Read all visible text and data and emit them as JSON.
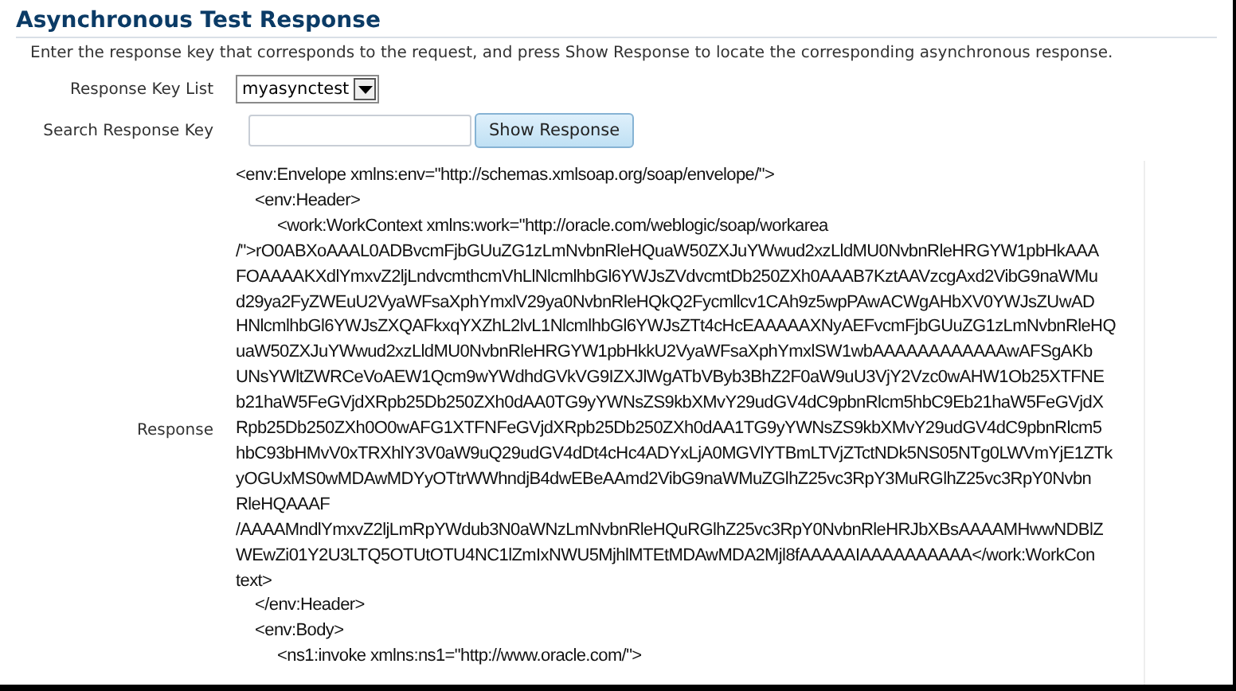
{
  "title": "Asynchronous Test Response",
  "description": "Enter the response key that corresponds to the request, and press Show Response to locate the corresponding asynchronous response.",
  "response_key_list": {
    "label": "Response Key List",
    "value": "myasynctest"
  },
  "search_response_key": {
    "label": "Search Response Key",
    "button": "Show Response"
  },
  "response": {
    "label": "Response",
    "lines": [
      {
        "kind": "flush",
        "text": "<env:Envelope xmlns:env=\"http://schemas.xmlsoap.org/soap/envelope/\">"
      },
      {
        "kind": "indent",
        "text": "<env:Header>"
      },
      {
        "kind": "double",
        "text": "<work:WorkContext xmlns:work=\"http://oracle.com/weblogic/soap/workarea"
      },
      {
        "kind": "flush",
        "text": "/\">rO0ABXoAAAL0ADBvcmFjbGUuZG1zLmNvbnRleHQuaW50ZXJuYWwud2xzLldMU0NvbnRleHRGYW1pbHkAAA"
      },
      {
        "kind": "flush",
        "text": "FOAAAAKXdlYmxvZ2ljLndvcmthcmVhLlNlcmlhbGl6YWJsZVdvcmtDb250ZXh0AAAB7KztAAVzcgAxd2VibG9naWMu"
      },
      {
        "kind": "flush",
        "text": "d29ya2FyZWEuU2VyaWFsaXphYmxlV29ya0NvbnRleHQkQ2Fycmllcv1CAh9z5wpPAwACWgAHbXV0YWJsZUwAD"
      },
      {
        "kind": "flush",
        "text": "HNlcmlhbGl6YWJsZXQAFkxqYXZhL2lvL1NlcmlhbGl6YWJsZTt4cHcEAAAAAXNyAEFvcmFjbGUuZG1zLmNvbnRleHQ"
      },
      {
        "kind": "flush",
        "text": "uaW50ZXJuYWwud2xzLldMU0NvbnRleHRGYW1pbHkkU2VyaWFsaXphYmxlSW1wbAAAAAAAAAAAAwAFSgAKb"
      },
      {
        "kind": "flush",
        "text": "UNsYWltZWRCeVoAEW1Qcm9wYWdhdGVkVG9IZXJlWgATbVByb3BhZ2F0aW9uU3VjY2Vzc0wAHW1Ob25XTFNE"
      },
      {
        "kind": "flush",
        "text": "b21haW5FeGVjdXRpb25Db250ZXh0dAA0TG9yYWNsZS9kbXMvY29udGV4dC9pbnRlcm5hbC9Eb21haW5FeGVjdX"
      },
      {
        "kind": "flush",
        "text": "Rpb25Db250ZXh0O0wAFG1XTFNFeGVjdXRpb25Db250ZXh0dAA1TG9yYWNsZS9kbXMvY29udGV4dC9pbnRlcm5"
      },
      {
        "kind": "flush",
        "text": "hbC93bHMvV0xTRXhlY3V0aW9uQ29udGV4dDt4cHc4ADYxLjA0MGVlYTBmLTVjZTctNDk5NS05NTg0LWVmYjE1ZTk"
      },
      {
        "kind": "flush",
        "text": "yOGUxMS0wMDAwMDYyOTtrWWhndjB4dwEBeAAmd2VibG9naWMuZGlhZ25vc3RpY3MuRGlhZ25vc3RpY0Nvbn"
      },
      {
        "kind": "flush",
        "text": "RleHQAAAF"
      },
      {
        "kind": "flush",
        "text": "/AAAAMndlYmxvZ2ljLmRpYWdub3N0aWNzLmNvbnRleHQuRGlhZ25vc3RpY0NvbnRleHRJbXBsAAAAMHwwNDBlZ"
      },
      {
        "kind": "flush",
        "text": "WEwZi01Y2U3LTQ5OTUtOTU4NC1lZmIxNWU5MjhlMTEtMDAwMDA2Mjl8fAAAAAIAAAAAAAAAA</work:WorkCon"
      },
      {
        "kind": "flush",
        "text": "text>"
      },
      {
        "kind": "indent",
        "text": "</env:Header>"
      },
      {
        "kind": "indent",
        "text": "<env:Body>"
      },
      {
        "kind": "double",
        "text": "<ns1:invoke xmlns:ns1=\"http://www.oracle.com/\">"
      }
    ]
  }
}
